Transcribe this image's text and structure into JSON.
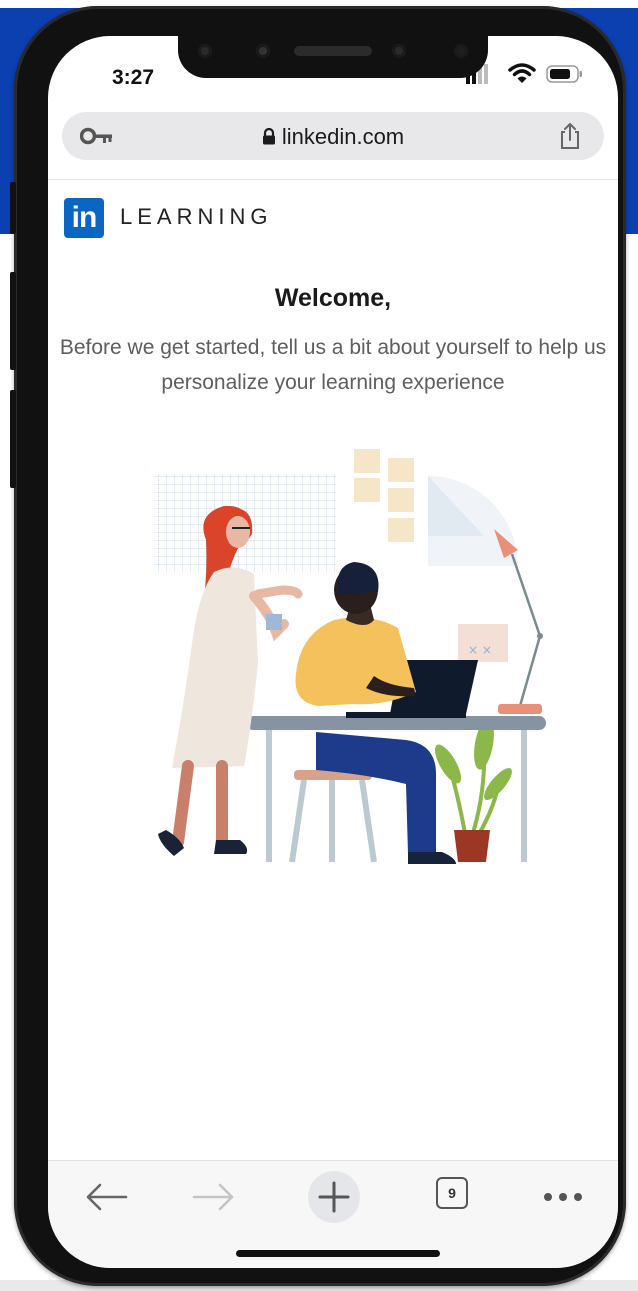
{
  "status_bar": {
    "time": "3:27"
  },
  "browser": {
    "url": "linkedin.com",
    "tab_count": "9",
    "icons": [
      "key-icon",
      "lock-icon",
      "share-icon",
      "back-arrow-icon",
      "forward-arrow-icon",
      "new-tab-plus-icon",
      "tabs-count-icon",
      "more-icon"
    ]
  },
  "brand": {
    "logo_text": "in",
    "wordmark": "LEARNING",
    "color": "#0a66c2"
  },
  "page": {
    "title": "Welcome,",
    "subtitle": "Before we get started, tell us a bit about yourself to help us personalize your learning experience"
  },
  "illustration": {
    "name": "two-people-at-desk-illustration"
  },
  "colors": {
    "background_band": "#0c3fb0",
    "text_primary": "#1a1a1a",
    "text_secondary": "#5e5e5e"
  }
}
